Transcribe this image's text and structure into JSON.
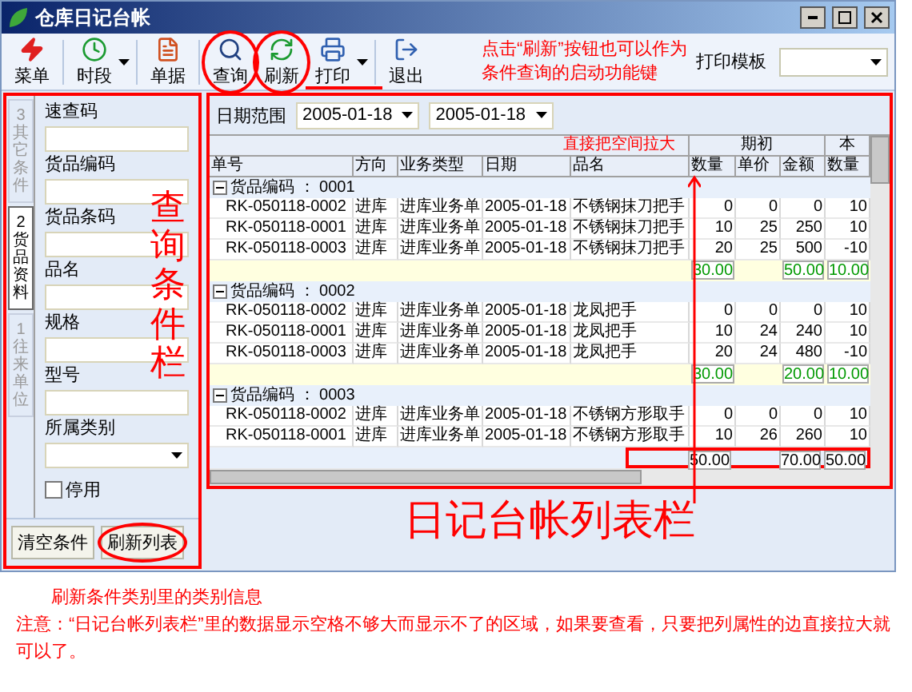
{
  "window": {
    "title": "仓库日记台帐"
  },
  "toolbar": {
    "buttons": [
      {
        "label": "菜单",
        "kind": "menu",
        "has_menu": false,
        "circled": false
      },
      {
        "label": "时段",
        "kind": "clock",
        "has_menu": true,
        "circled": false
      },
      {
        "label": "单据",
        "kind": "document",
        "has_menu": false,
        "circled": false
      },
      {
        "label": "查询",
        "kind": "search",
        "has_menu": false,
        "circled": true
      },
      {
        "label": "刷新",
        "kind": "refresh",
        "has_menu": false,
        "circled": true
      },
      {
        "label": "打印",
        "kind": "print",
        "has_menu": true,
        "circled": false
      },
      {
        "label": "退出",
        "kind": "exit",
        "has_menu": false,
        "circled": false
      }
    ],
    "note": [
      "点击“刷新”按钮也可以作为",
      "条件查询的启动功能键"
    ],
    "print_template": {
      "label": "打印模板"
    }
  },
  "sidebar": {
    "tabs": [
      {
        "label": "3 其它条件",
        "selected": false
      },
      {
        "label": "2 货品资料",
        "selected": true
      },
      {
        "label": "1 往来单位",
        "selected": false
      }
    ],
    "fields": [
      {
        "label": "速查码",
        "kind": "text"
      },
      {
        "label": "货品编码",
        "kind": "text"
      },
      {
        "label": "货品条码",
        "kind": "text"
      },
      {
        "label": "品名",
        "kind": "text"
      },
      {
        "label": "规格",
        "kind": "text"
      },
      {
        "label": "型号",
        "kind": "text"
      },
      {
        "label": "所属类别",
        "kind": "select"
      }
    ],
    "checkbox": {
      "label": "停用",
      "checked": false
    },
    "buttons": [
      {
        "label": "清空条件",
        "circled": false
      },
      {
        "label": "刷新列表",
        "circled": true
      }
    ],
    "overlay_label": "查询条件栏"
  },
  "date_range": {
    "label": "日期范围",
    "from": "2005-01-18",
    "to": "2005-01-18"
  },
  "table": {
    "note": "直接把空间拉大",
    "group_headers": [
      "期初",
      "本"
    ],
    "columns": [
      "单号",
      "方向",
      "业务类型",
      "日期",
      "品名",
      "数量",
      "单价",
      "金额",
      "数量"
    ],
    "groups": [
      {
        "label": "货品编码 ： 0001",
        "expanded": true,
        "rows": [
          [
            "RK-050118-0002",
            "进库",
            "进库业务单",
            "2005-01-18",
            "不锈钢抹刀把手",
            "0",
            "0",
            "0",
            "10"
          ],
          [
            "RK-050118-0001",
            "进库",
            "进库业务单",
            "2005-01-18",
            "不锈钢抹刀把手",
            "10",
            "25",
            "250",
            "10"
          ],
          [
            "RK-050118-0003",
            "进库",
            "进库业务单",
            "2005-01-18",
            "不锈钢抹刀把手",
            "20",
            "25",
            "500",
            "-10"
          ]
        ],
        "subtotal": {
          "opening_quantity": "30.00",
          "opening_amount": "50.00",
          "current_quantity": "10.00"
        }
      },
      {
        "label": "货品编码 ： 0002",
        "expanded": true,
        "rows": [
          [
            "RK-050118-0002",
            "进库",
            "进库业务单",
            "2005-01-18",
            "龙凤把手",
            "0",
            "0",
            "0",
            "10"
          ],
          [
            "RK-050118-0001",
            "进库",
            "进库业务单",
            "2005-01-18",
            "龙凤把手",
            "10",
            "24",
            "240",
            "10"
          ],
          [
            "RK-050118-0003",
            "进库",
            "进库业务单",
            "2005-01-18",
            "龙凤把手",
            "20",
            "24",
            "480",
            "-10"
          ]
        ],
        "subtotal": {
          "opening_quantity": "30.00",
          "opening_amount": "20.00",
          "current_quantity": "10.00"
        }
      },
      {
        "label": "货品编码 ： 0003",
        "expanded": true,
        "rows": [
          [
            "RK-050118-0002",
            "进库",
            "进库业务单",
            "2005-01-18",
            "不锈钢方形取手",
            "0",
            "0",
            "0",
            "10"
          ],
          [
            "RK-050118-0001",
            "进库",
            "进库业务单",
            "2005-01-18",
            "不锈钢方形取手",
            "10",
            "26",
            "260",
            "10"
          ]
        ]
      }
    ],
    "total": {
      "opening_quantity": "50.00",
      "opening_amount": "70.00",
      "current_quantity": "50.00"
    }
  },
  "list_label": "日记台帐列表栏",
  "notes": [
    "刷新条件类别里的类别信息",
    "注意：“日记台帐列表栏”里的数据显示空格不够大而显示不了的区域，如果要查看，只要把列属性的边直接拉大就可以了。"
  ]
}
